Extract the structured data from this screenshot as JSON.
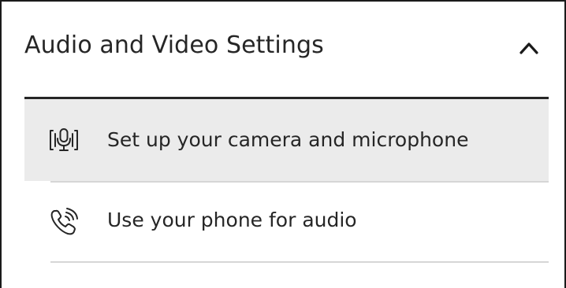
{
  "panel": {
    "title": "Audio and Video Settings",
    "collapse_icon": "chevron-up-icon"
  },
  "items": [
    {
      "label": "Set up your camera and microphone",
      "icon": "camera-microphone-icon",
      "selected": true
    },
    {
      "label": "Use your phone for audio",
      "icon": "phone-audio-icon",
      "selected": false
    }
  ],
  "colors": {
    "text": "#262626",
    "selected_background": "#ebebeb",
    "divider": "#d6d6d6",
    "border": "#1a1a1a"
  }
}
